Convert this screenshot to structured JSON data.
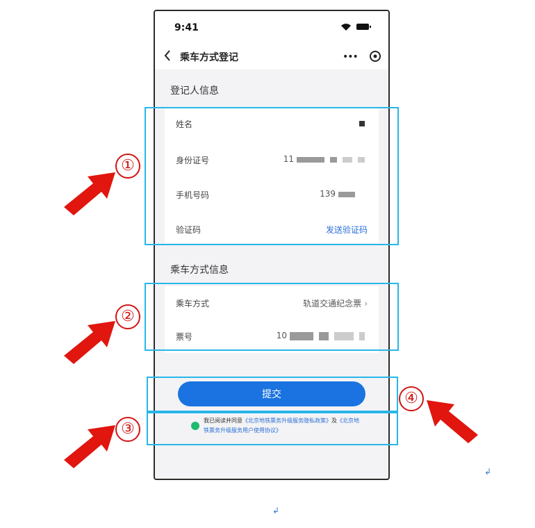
{
  "status": {
    "time": "9:41"
  },
  "nav": {
    "title": "乘车方式登记"
  },
  "registrant": {
    "section_title": "登记人信息",
    "rows": [
      {
        "label": "姓名",
        "value": ""
      },
      {
        "label": "身份证号",
        "value": "11"
      },
      {
        "label": "手机号码",
        "value": "139"
      },
      {
        "label": "验证码",
        "value": "发送验证码"
      }
    ]
  },
  "ride": {
    "section_title": "乘车方式信息",
    "rows": [
      {
        "label": "乘车方式",
        "value": "轨道交通纪念票"
      },
      {
        "label": "票号",
        "value": "10"
      }
    ]
  },
  "submit": {
    "label": "提交"
  },
  "agreement": {
    "prefix": "我已阅读并同意",
    "link1": "《北京地铁票务升级服务隐私政策》",
    "middle": "及",
    "link2": "《北京地铁票务升级服务用户使用协议》"
  },
  "annotations": {
    "n1": "①",
    "n2": "②",
    "n3": "③",
    "n4": "④",
    "para": "↲"
  },
  "colors": {
    "highlight": "#28b6e8",
    "arrow": "#e0160f",
    "primary": "#1a73e0",
    "check": "#1fba6f"
  }
}
